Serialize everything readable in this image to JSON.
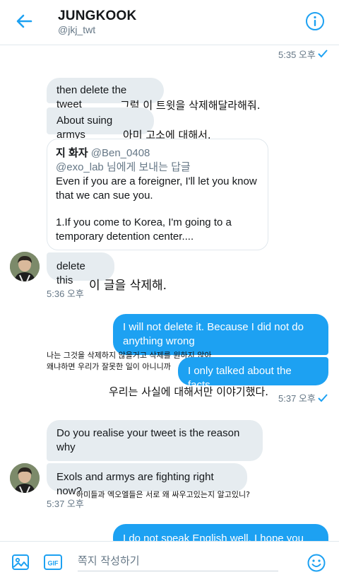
{
  "header": {
    "title": "JUNGKOOK",
    "handle": "@jkj_twt"
  },
  "messages": {
    "ts_top": "5:35 오후",
    "m1": "then delete the tweet",
    "m1_ko": "그럼 이 트윗을 삭제해달라해줘.",
    "m2": "About suing armys",
    "m2_ko": "아미 고소에 대해서.",
    "quote": {
      "name": "지 화자",
      "handle": "@Ben_0408",
      "reply_to": "@exo_lab 님에게 보내는 답글",
      "line1": "Even if you are a foreigner, I'll let you know",
      "line2": "that we can sue you.",
      "line3": "1.If you come to Korea, I'm going to a",
      "line4": "temporary detention center...."
    },
    "m3": "delete this",
    "m3_ko": "이 글을 삭제해.",
    "ts_in1": "5:36 오후",
    "o1_line1": "I will not delete it. Because I did not do",
    "o1_line2": "anything wrong",
    "o1_ko1": "나는 그것을 삭제하지 않을거고 삭제를 원하지 않아",
    "o1_ko2": "왜냐하면  우리가 잘못한 일이 아니니까",
    "o2": "I only talked about the facts.",
    "o2_ko": "우리는 사실에 대해서만 이야기했다.",
    "ts_out1": "5:37 오후",
    "m4_line1": "Do you realise your tweet is the reason",
    "m4_line2": "why",
    "m5": "Exols and armys are fighting right now?",
    "m5_ko": "아미들과 엑오엘들은 서로 왜 싸우고있는지 알고있니?",
    "ts_in2": "5:37 오후",
    "o3_partial": "I do not speak English well. I hope you"
  },
  "composer": {
    "placeholder": "쪽지 작성하기",
    "gif_label": "GIF"
  },
  "colors": {
    "accent": "#1da1f2",
    "incoming_bubble": "#e6ecf0"
  }
}
